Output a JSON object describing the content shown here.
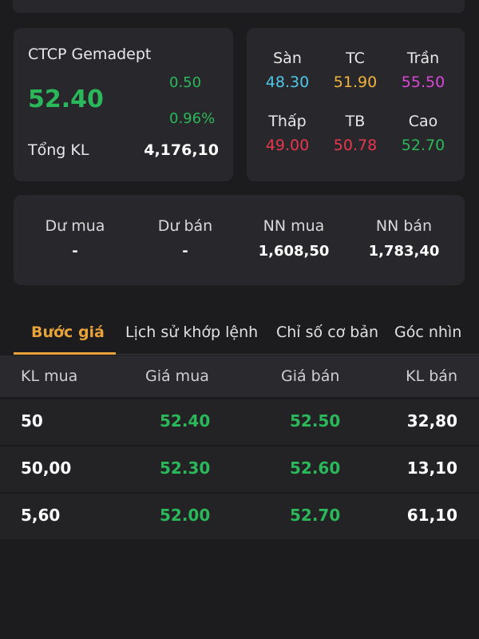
{
  "summary": {
    "company": "CTCP Gemadept",
    "price": "52.40",
    "change": "0.50",
    "change_pct": "0.96%",
    "volume_label": "Tổng KL",
    "volume_value": "4,176,10"
  },
  "ref": {
    "san_label": "Sàn",
    "san_value": "48.30",
    "tc_label": "TC",
    "tc_value": "51.90",
    "tran_label": "Trần",
    "tran_value": "55.50",
    "thap_label": "Thấp",
    "thap_value": "49.00",
    "tb_label": "TB",
    "tb_value": "50.78",
    "cao_label": "Cao",
    "cao_value": "52.70"
  },
  "colors": {
    "san": "#4fc8e8",
    "tc": "#f0b43c",
    "tran": "#d946d9",
    "thap": "#e8364e",
    "tb": "#e8364e",
    "cao": "#2bb85a"
  },
  "market": {
    "du_mua_label": "Dư mua",
    "du_mua_value": "-",
    "du_ban_label": "Dư bán",
    "du_ban_value": "-",
    "nn_mua_label": "NN mua",
    "nn_mua_value": "1,608,50",
    "nn_ban_label": "NN bán",
    "nn_ban_value": "1,783,40"
  },
  "tabs": [
    "Bước giá",
    "Lịch sử khớp lệnh",
    "Chỉ số cơ bản",
    "Góc nhìn"
  ],
  "table": {
    "headers": [
      "KL mua",
      "Giá mua",
      "Giá bán",
      "KL bán"
    ],
    "rows": [
      [
        "50",
        "52.40",
        "52.50",
        "32,80"
      ],
      [
        "50,00",
        "52.30",
        "52.60",
        "13,10"
      ],
      [
        "5,60",
        "52.00",
        "52.70",
        "61,10"
      ]
    ]
  }
}
